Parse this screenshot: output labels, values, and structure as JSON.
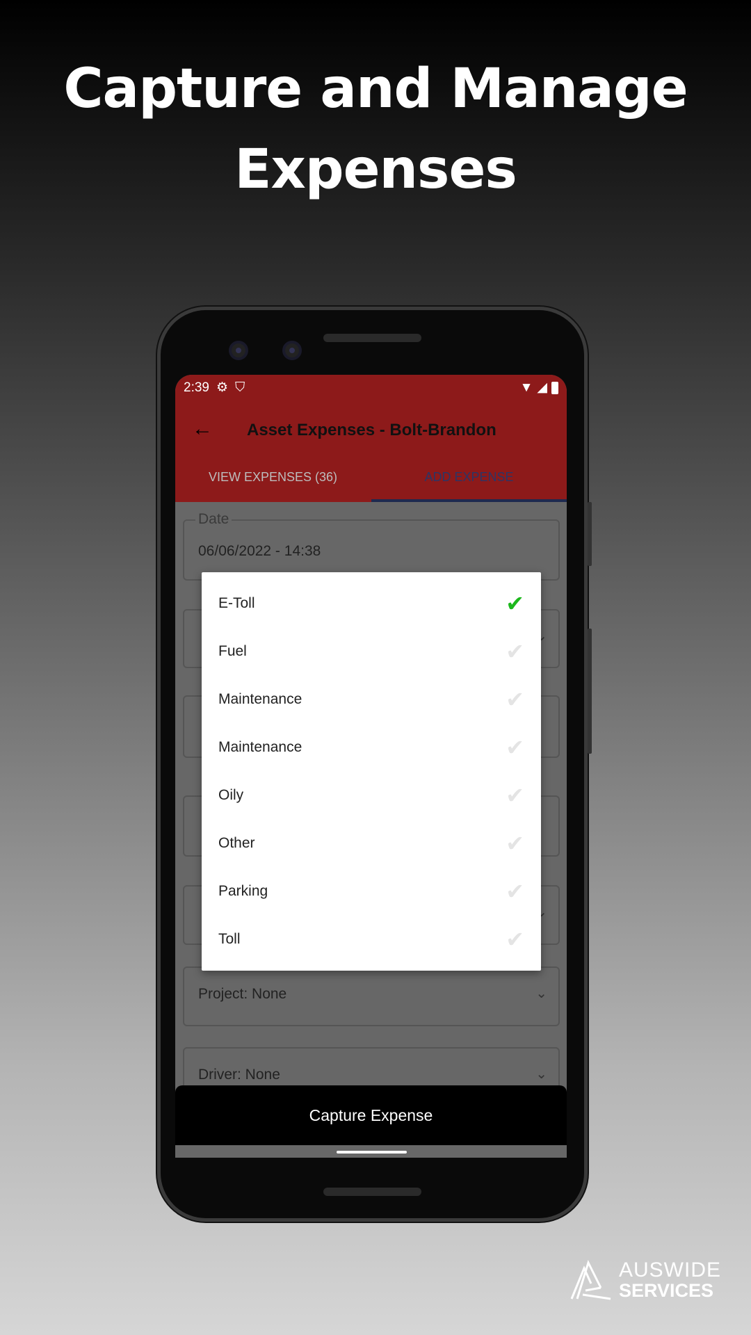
{
  "headline": {
    "line1": "Capture and Manage",
    "line2": "Expenses"
  },
  "status_bar": {
    "time": "2:39",
    "icons": [
      "gear-icon",
      "shield-play-icon",
      "wifi-icon",
      "signal-icon",
      "battery-icon"
    ]
  },
  "app_bar": {
    "title": "Asset Expenses - Bolt-Brandon",
    "back_icon": "arrow-left-icon",
    "color": "#8d1a1a"
  },
  "tabs": [
    {
      "label": "VIEW EXPENSES (36)",
      "active": false
    },
    {
      "label": "ADD EXPENSE",
      "active": true
    }
  ],
  "form": {
    "date_label": "Date",
    "date_value": "06/06/2022 - 14:38",
    "project": "Project: None",
    "driver": "Driver: None"
  },
  "dialog": {
    "options": [
      {
        "label": "E-Toll",
        "selected": true
      },
      {
        "label": "Fuel",
        "selected": false
      },
      {
        "label": "Maintenance",
        "selected": false
      },
      {
        "label": "Maintenance",
        "selected": false
      },
      {
        "label": "Oily",
        "selected": false
      },
      {
        "label": "Other",
        "selected": false
      },
      {
        "label": "Parking",
        "selected": false
      },
      {
        "label": "Toll",
        "selected": false
      }
    ],
    "check_color": "#1cb81c"
  },
  "capture_button": "Capture Expense",
  "logo": {
    "line1": "AUSWIDE",
    "line2": "SERVICES"
  }
}
